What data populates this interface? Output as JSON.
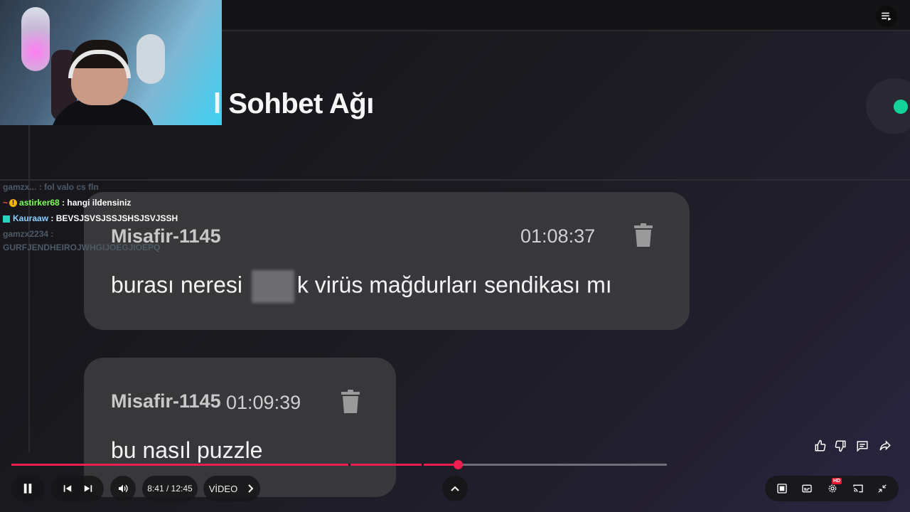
{
  "page": {
    "title": "l Sohbet Ağı"
  },
  "messages": [
    {
      "author": "Misafir-1145",
      "time": "01:08:37",
      "text_before": "burası neresi ",
      "text_after": "k virüs mağdurları sendikası mı"
    },
    {
      "author": "Misafir-1145",
      "time": "01:09:39",
      "text": "bu nasıl puzzle"
    }
  ],
  "live_chat": [
    {
      "user": "gamzx...",
      "text": ": fol valo cs fln",
      "faded": true
    },
    {
      "user": "astirker68",
      "text": ": hangi ildensiniz",
      "faded": false
    },
    {
      "user": "Kauraaw",
      "text": ": BEVSJSVSJSSJSHSJSVJSSH",
      "faded": false
    },
    {
      "user": "gamzx2234",
      "text": ":",
      "faded": true
    },
    {
      "user": "",
      "text": "GURFJENDHEIROJWHGIJOEGJIOEPQ",
      "faded": true
    }
  ],
  "player": {
    "time_current": "8:41",
    "time_total": "12:45",
    "time_display": "8:41 / 12:45",
    "chapter_label": "VİDEO",
    "progress_fraction": 0.6815,
    "hd_badge": "HD",
    "accent_color": "#e91e4f"
  },
  "icons": {
    "queue": "playlist-icon",
    "trash": "trash-icon",
    "pause": "pause-icon",
    "previous": "skip-previous-icon",
    "next": "skip-next-icon",
    "volume": "volume-icon",
    "chevron": "chevron-right-icon",
    "expand": "chevron-up-icon",
    "like": "thumbs-up-icon",
    "dislike": "thumbs-down-icon",
    "comment": "comment-icon",
    "share": "share-icon",
    "autoplay": "autoplay-icon",
    "captions": "captions-icon",
    "settings": "gear-icon",
    "cast": "cast-icon",
    "minimize": "minimize-icon"
  },
  "colors": {
    "status_online": "#14d39a",
    "progress": "#e91e4f"
  }
}
